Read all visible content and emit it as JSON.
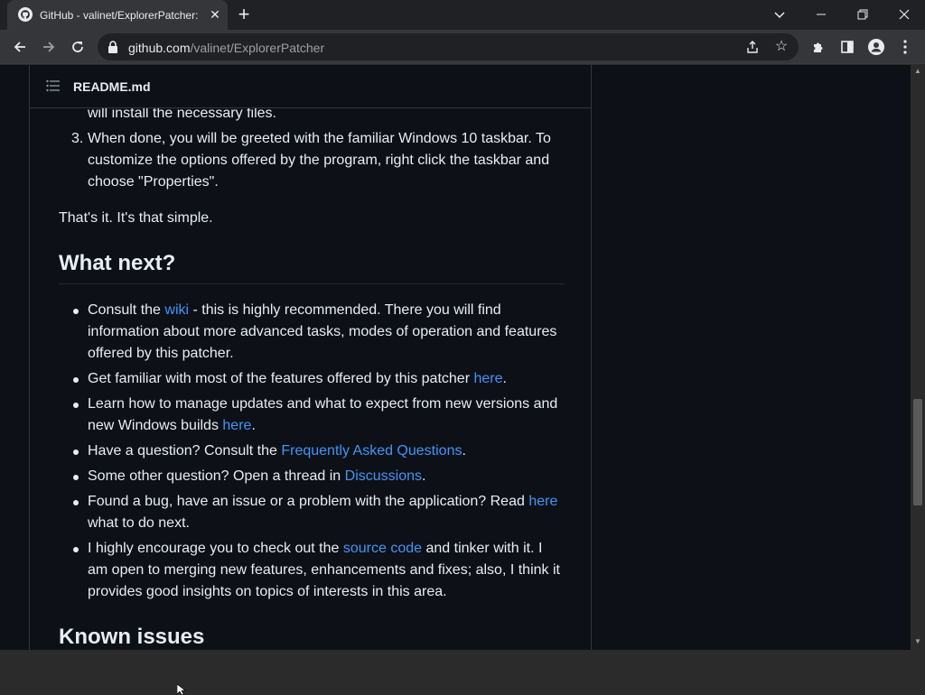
{
  "browser": {
    "tab_title": "GitHub - valinet/ExplorerPatcher: This project aims to enhance the working environment on Windows",
    "url_host": "github.com",
    "url_path": "/valinet/ExplorerPatcher"
  },
  "readme": {
    "filename": "README.md"
  },
  "content": {
    "partial_line": "will install the necessary files.",
    "step3_number": "3.",
    "step3_line1": "When done, you will be greeted with the familiar Windows 10 taskbar. To",
    "step3_line2": "customize the options offered by the program, right click the taskbar and",
    "step3_line3": "choose \"Properties\".",
    "thats_it": "That's it. It's that simple.",
    "h_what_next": "What next?",
    "b1_pre": "Consult the ",
    "b1_link": "wiki",
    "b1_post": " - this is highly recommended. There you will find",
    "b1_line2": "information about more advanced tasks, modes of operation and features",
    "b1_line3": "offered by this patcher.",
    "b2_pre": "Get familiar with most of the features offered by this patcher ",
    "b2_link": "here",
    "b2_post": ".",
    "b3_line1": "Learn how to manage updates and what to expect from new versions and",
    "b3_pre": "new Windows builds ",
    "b3_link": "here",
    "b3_post": ".",
    "b4_pre": "Have a question? Consult the ",
    "b4_link": "Frequently Asked Questions",
    "b4_post": ".",
    "b5_pre": "Some other question? Open a thread in ",
    "b5_link": "Discussions",
    "b5_post": ".",
    "b6_pre": "Found a bug, have an issue or a problem with the application? Read ",
    "b6_link": "here",
    "b6_line2": "what to do next.",
    "b7_pre": "I highly encourage you to check out the ",
    "b7_link": "source code",
    "b7_post": " and tinker with it. I",
    "b7_line2": "am open to merging new features, enhancements and fixes; also, I think it",
    "b7_line3": "provides good insights on topics of interests in this area.",
    "h_known_issues": "Known issues"
  },
  "colors": {
    "page_bg": "#0d1117",
    "link": "#4493f8",
    "text": "#e6edf3"
  }
}
